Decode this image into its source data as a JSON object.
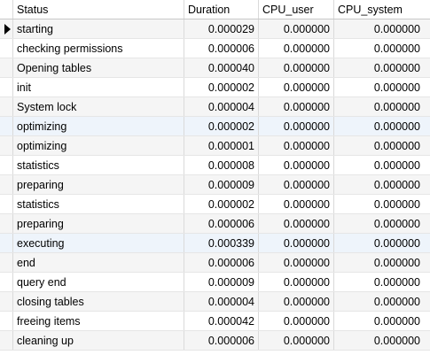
{
  "table": {
    "columns": [
      "Status",
      "Duration",
      "CPU_user",
      "CPU_system"
    ],
    "rows": [
      [
        "starting",
        "0.000029",
        "0.000000",
        "0.000000"
      ],
      [
        "checking permissions",
        "0.000006",
        "0.000000",
        "0.000000"
      ],
      [
        "Opening tables",
        "0.000040",
        "0.000000",
        "0.000000"
      ],
      [
        "init",
        "0.000002",
        "0.000000",
        "0.000000"
      ],
      [
        "System lock",
        "0.000004",
        "0.000000",
        "0.000000"
      ],
      [
        "optimizing",
        "0.000002",
        "0.000000",
        "0.000000"
      ],
      [
        "optimizing",
        "0.000001",
        "0.000000",
        "0.000000"
      ],
      [
        "statistics",
        "0.000008",
        "0.000000",
        "0.000000"
      ],
      [
        "preparing",
        "0.000009",
        "0.000000",
        "0.000000"
      ],
      [
        "statistics",
        "0.000002",
        "0.000000",
        "0.000000"
      ],
      [
        "preparing",
        "0.000006",
        "0.000000",
        "0.000000"
      ],
      [
        "executing",
        "0.000339",
        "0.000000",
        "0.000000"
      ],
      [
        "end",
        "0.000006",
        "0.000000",
        "0.000000"
      ],
      [
        "query end",
        "0.000009",
        "0.000000",
        "0.000000"
      ],
      [
        "closing tables",
        "0.000004",
        "0.000000",
        "0.000000"
      ],
      [
        "freeing items",
        "0.000042",
        "0.000000",
        "0.000000"
      ],
      [
        "cleaning up",
        "0.000006",
        "0.000000",
        "0.000000"
      ]
    ],
    "current_row_icon": "row-pointer-icon"
  }
}
